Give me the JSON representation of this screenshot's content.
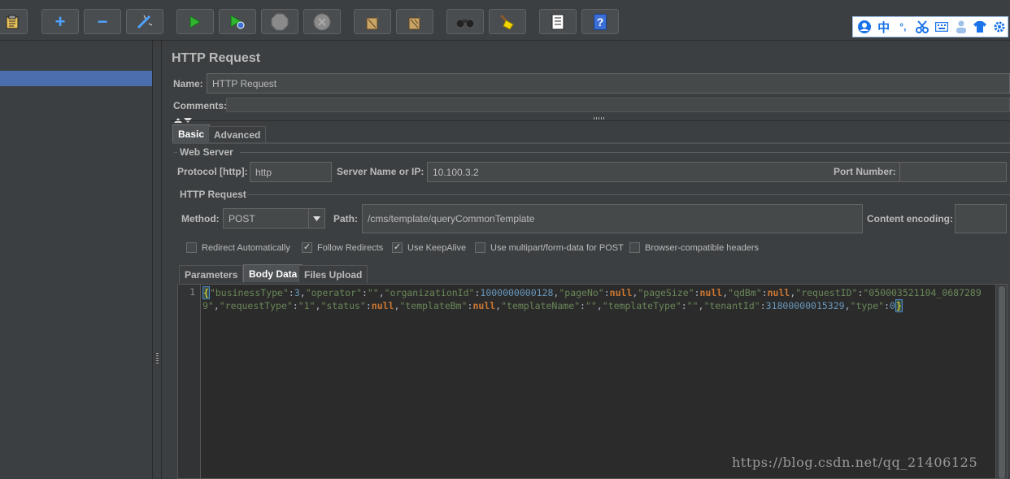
{
  "toolbar": {
    "buttons": [
      {
        "name": "templates",
        "icon": "clipboard-icon"
      },
      {
        "name": "expand",
        "icon": "plus-icon",
        "label": "+"
      },
      {
        "name": "collapse",
        "icon": "minus-icon",
        "label": "−"
      },
      {
        "name": "toggle",
        "icon": "wand-icon"
      },
      {
        "name": "start",
        "icon": "play-icon"
      },
      {
        "name": "start-no-pauses",
        "icon": "play-no-timers-icon"
      },
      {
        "name": "stop",
        "icon": "stop-icon"
      },
      {
        "name": "shutdown",
        "icon": "shutdown-icon"
      },
      {
        "name": "clear",
        "icon": "broom-icon"
      },
      {
        "name": "clear-all",
        "icon": "broom-all-icon"
      },
      {
        "name": "search",
        "icon": "binoculars-icon"
      },
      {
        "name": "reset-search",
        "icon": "reset-search-icon"
      },
      {
        "name": "function-helper",
        "icon": "list-icon"
      },
      {
        "name": "help",
        "icon": "help-icon",
        "label": "?"
      }
    ]
  },
  "ime": {
    "items": [
      "user-icon",
      "中",
      "°,",
      "scissors-icon",
      "keyboard-icon",
      "person-icon",
      "shirt-icon",
      "gear-icon"
    ]
  },
  "panel": {
    "title": "HTTP Request",
    "name_label": "Name:",
    "name_value": "HTTP Request",
    "comments_label": "Comments:",
    "tabs": [
      "Basic",
      "Advanced"
    ],
    "web_server": {
      "title": "Web Server",
      "protocol_label": "Protocol [http]:",
      "protocol_value": "http",
      "server_label": "Server Name or IP:",
      "server_value": "10.100.3.2",
      "port_label": "Port Number:",
      "port_value": ""
    },
    "http_request": {
      "title": "HTTP Request",
      "method_label": "Method:",
      "method_value": "POST",
      "path_label": "Path:",
      "path_value": "/cms/template/queryCommonTemplate",
      "encoding_label": "Content encoding:",
      "encoding_value": ""
    },
    "checkboxes": [
      {
        "label": "Redirect Automatically",
        "checked": false
      },
      {
        "label": "Follow Redirects",
        "checked": true
      },
      {
        "label": "Use KeepAlive",
        "checked": true
      },
      {
        "label": "Use multipart/form-data for POST",
        "checked": false
      },
      {
        "label": "Browser-compatible headers",
        "checked": false
      }
    ],
    "body_tabs": [
      "Parameters",
      "Body Data",
      "Files Upload"
    ],
    "editor": {
      "line_number": "1",
      "body": "{\"businessType\":3,\"operator\":\"\",\"organizationId\":1000000000128,\"pageNo\":null,\"pageSize\":null,\"qdBm\":null,\"requestID\":\"050003521104_06872899\",\"requestType\":\"1\",\"status\":null,\"templateBm\":null,\"templateName\":\"\",\"templateType\":\"\",\"tenantId\":31800000015329,\"type\":0}"
    }
  },
  "watermark": "https://blog.csdn.net/qq_21406125",
  "colors": {
    "background": "#3c3f41",
    "selection": "#4b6eaf",
    "editor_bg": "#2b2b2b",
    "json_key": "#6a8759",
    "json_number": "#6897bb",
    "json_null": "#cc7832"
  }
}
